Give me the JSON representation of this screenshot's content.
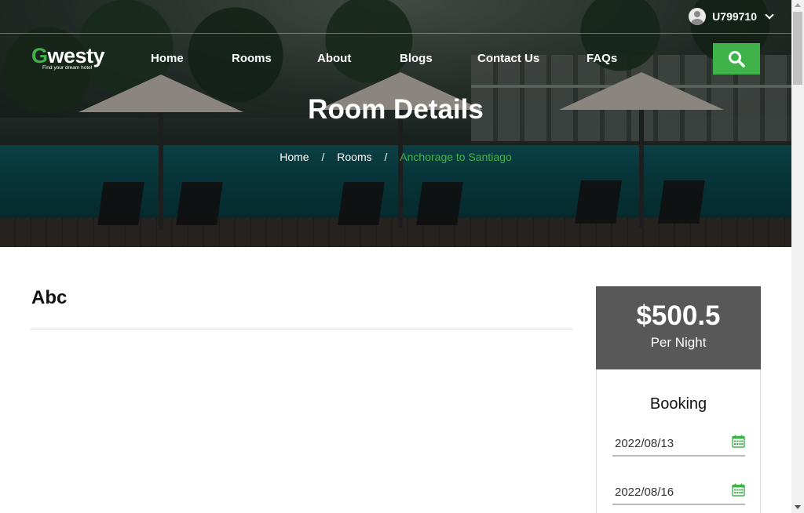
{
  "user": {
    "name": "U799710",
    "icon": "user-avatar-icon"
  },
  "logo": {
    "first_letter": "G",
    "rest": "westy",
    "tagline": "Find your dream hotel"
  },
  "nav": {
    "items": [
      {
        "label": "Home"
      },
      {
        "label": "Rooms"
      },
      {
        "label": "About"
      },
      {
        "label": "Blogs"
      },
      {
        "label": "Contact Us"
      },
      {
        "label": "FAQs"
      }
    ],
    "search_icon": "search-icon"
  },
  "hero": {
    "title": "Room Details",
    "breadcrumb": {
      "home": "Home",
      "rooms": "Rooms",
      "current": "Anchorage to Santiago",
      "separator": "/"
    }
  },
  "room": {
    "name": "Abc"
  },
  "pricing": {
    "price": "$500.5",
    "per": "Per Night"
  },
  "booking": {
    "title": "Booking",
    "check_in": "2022/08/13",
    "check_out": "2022/08/16"
  },
  "colors": {
    "accent": "#3fb34a",
    "price_card": "#585858"
  }
}
